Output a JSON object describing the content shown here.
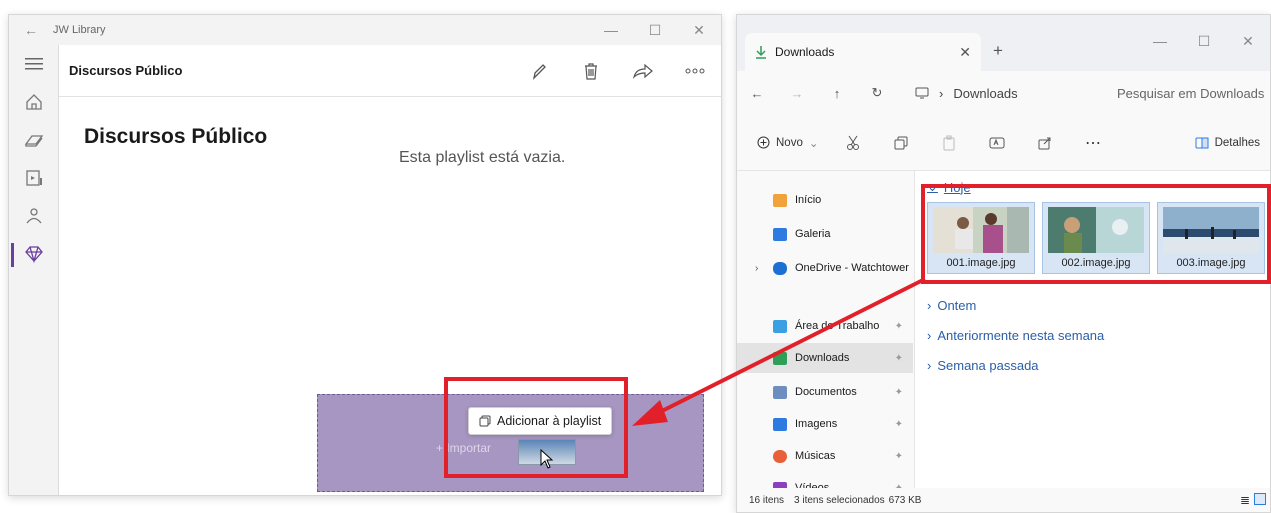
{
  "jw_library": {
    "app_title": "JW Library",
    "header_title": "Discursos Público",
    "page_title": "Discursos Público",
    "empty_message": "Esta playlist está vazia.",
    "drop_label": "+ Importar",
    "tooltip_label": "Adicionar à playlist",
    "sidebar_icons": [
      "home-icon",
      "book-icon",
      "video-icon",
      "people-icon",
      "gem-icon"
    ],
    "header_actions": [
      "pencil-icon",
      "trash-icon",
      "share-icon",
      "more-icon"
    ]
  },
  "explorer": {
    "tab_title": "Downloads",
    "address": "Downloads",
    "search_placeholder": "Pesquisar em Downloads",
    "toolbar": {
      "new_label": "Novo",
      "details_label": "Detalhes"
    },
    "nav_items": [
      {
        "label": "Início",
        "icon": "home-icon",
        "color": "#f2a23a"
      },
      {
        "label": "Galeria",
        "icon": "gallery-icon",
        "color": "#2d7be0"
      },
      {
        "label": "OneDrive - Watchtower",
        "icon": "cloud-icon",
        "color": "#1e6fd2"
      },
      {
        "label": "Área de Trabalho",
        "icon": "desktop-icon",
        "color": "#3aa0e3"
      },
      {
        "label": "Downloads",
        "icon": "download-icon",
        "color": "#2f9e58"
      },
      {
        "label": "Documentos",
        "icon": "documents-icon",
        "color": "#6c8fbf"
      },
      {
        "label": "Imagens",
        "icon": "pictures-icon",
        "color": "#2d7be0"
      },
      {
        "label": "Músicas",
        "icon": "music-icon",
        "color": "#e8603a"
      },
      {
        "label": "Vídeos",
        "icon": "videos-icon",
        "color": "#8c3fbf"
      }
    ],
    "groups": {
      "today": "Hoje",
      "yesterday": "Ontem",
      "earlier_week": "Anteriormente nesta semana",
      "last_week": "Semana passada"
    },
    "files": [
      {
        "name": "001.image.jpg"
      },
      {
        "name": "002.image.jpg"
      },
      {
        "name": "003.image.jpg"
      }
    ],
    "status": {
      "count": "16 itens",
      "selection": "3 itens selecionados",
      "size": "673 KB"
    }
  },
  "colors": {
    "highlight_red": "#e2202a",
    "jw_purple": "#6a3f9e",
    "drop_zone": "#a796c2"
  }
}
